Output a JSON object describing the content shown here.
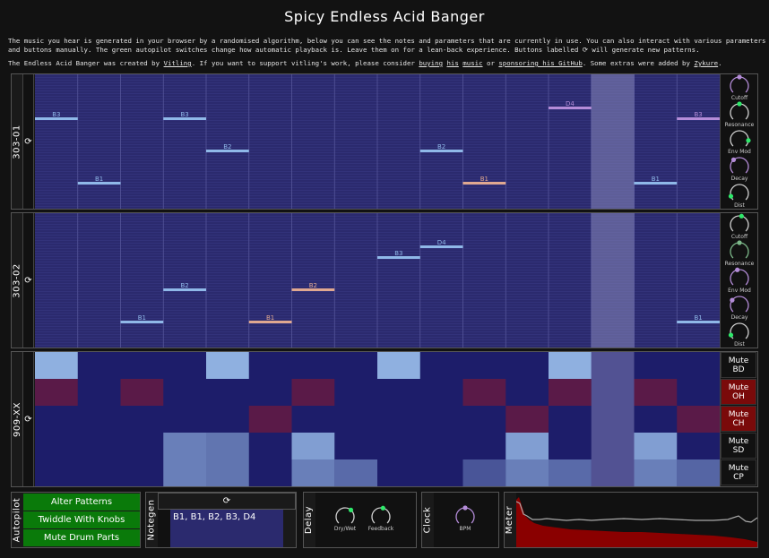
{
  "title": "Spicy Endless Acid Banger",
  "intro": {
    "para1_line1": "The music you hear is generated in your browser by a randomised algorithm, below you can see the notes and parameters that are currently in use. You can also interact with various parameters",
    "para1_line2": "and buttons manually. The green autopilot switches change how automatic playback is. Leave them on for a lean-back experience. Buttons labelled ⟳ will generate new patterns.",
    "para2_a": "The Endless Acid Banger was created by ",
    "link_vitling": "Vitling",
    "para2_b": ". If you want to support vitling's work, please consider ",
    "link_buying": "buying",
    "link_his": "his",
    "link_music": "music",
    "para2_c": " or ",
    "link_sponsor": "sponsoring his GitHub",
    "para2_d": ". Some extras were added by ",
    "link_zykure": "Zykure",
    "para2_e": "."
  },
  "regen_symbol": "⟳",
  "current_step": 13,
  "synth1": {
    "label": "303-01",
    "notes": [
      {
        "step": 0,
        "note": "B3",
        "kind": "normal"
      },
      {
        "step": 1,
        "note": "B1",
        "kind": "normal"
      },
      {
        "step": 3,
        "note": "B3",
        "kind": "normal"
      },
      {
        "step": 4,
        "note": "B2",
        "kind": "normal"
      },
      {
        "step": 9,
        "note": "B2",
        "kind": "normal"
      },
      {
        "step": 10,
        "note": "B1",
        "kind": "accent"
      },
      {
        "step": 12,
        "note": "D4",
        "kind": "slide"
      },
      {
        "step": 14,
        "note": "B1",
        "kind": "normal"
      },
      {
        "step": 15,
        "note": "B3",
        "kind": "slide"
      }
    ],
    "knobs": [
      {
        "label": "Cutoff",
        "value": 0.5,
        "color": "#b48cd8"
      },
      {
        "label": "Resonance",
        "value": 0.5,
        "color": "#2ee86a"
      },
      {
        "label": "Env Mod",
        "value": 0.85,
        "color": "#2ee86a"
      },
      {
        "label": "Decay",
        "value": 0.35,
        "color": "#b48cd8"
      },
      {
        "label": "Dist",
        "value": 0.1,
        "color": "#2ee86a"
      }
    ]
  },
  "synth2": {
    "label": "303-02",
    "notes": [
      {
        "step": 2,
        "note": "B1",
        "kind": "normal"
      },
      {
        "step": 3,
        "note": "B2",
        "kind": "normal"
      },
      {
        "step": 5,
        "note": "B1",
        "kind": "accent"
      },
      {
        "step": 6,
        "note": "B2",
        "kind": "accent"
      },
      {
        "step": 8,
        "note": "B3",
        "kind": "normal"
      },
      {
        "step": 9,
        "note": "D4",
        "kind": "normal"
      },
      {
        "step": 15,
        "note": "B1",
        "kind": "normal"
      }
    ],
    "knobs": [
      {
        "label": "Cutoff",
        "value": 0.55,
        "color": "#2ee86a"
      },
      {
        "label": "Resonance",
        "value": 0.5,
        "color": "#7cb889"
      },
      {
        "label": "Env Mod",
        "value": 0.45,
        "color": "#b48cd8"
      },
      {
        "label": "Decay",
        "value": 0.3,
        "color": "#b48cd8"
      },
      {
        "label": "Dist",
        "value": 0.1,
        "color": "#2ee86a"
      }
    ]
  },
  "drums": {
    "label": "909-XX",
    "rows": [
      {
        "mute_label": "Mute BD",
        "muted": false,
        "color": "#8fb0e0",
        "cells": [
          1,
          0,
          0,
          0,
          1,
          0,
          0,
          0,
          1,
          0,
          0,
          0,
          1,
          0,
          0,
          0
        ]
      },
      {
        "mute_label": "Mute OH",
        "muted": true,
        "color": "#5a1a48",
        "cells": [
          1,
          0,
          1,
          0,
          0,
          0,
          1,
          0,
          0,
          0,
          1,
          0,
          1,
          0,
          1,
          0
        ]
      },
      {
        "mute_label": "Mute CH",
        "muted": true,
        "color": "#5a1a48",
        "cells": [
          0,
          0,
          0,
          0,
          0,
          1,
          0,
          0,
          0,
          0,
          0,
          1,
          0,
          0,
          0,
          1
        ]
      },
      {
        "mute_label": "Mute SD",
        "muted": false,
        "color": "#8fb0e0",
        "cells": [
          0,
          0,
          0,
          0.6,
          0.5,
          0,
          0.9,
          0,
          0,
          0,
          0,
          0.9,
          0,
          0,
          0.9,
          0
        ]
      },
      {
        "mute_label": "Mute CP",
        "muted": false,
        "color": "#8fb0e0",
        "cells": [
          0,
          0,
          0,
          0.6,
          0.5,
          0,
          0.6,
          0.4,
          0,
          0,
          0.2,
          0.6,
          0.4,
          0,
          0.6,
          0.35
        ]
      }
    ]
  },
  "autopilot": {
    "label": "Autopilot",
    "buttons": [
      "Alter Patterns",
      "Twiddle With Knobs",
      "Mute Drum Parts"
    ]
  },
  "notegen": {
    "label": "Notegen",
    "notes": "B1, B1, B2, B3, D4"
  },
  "delay": {
    "label": "Delay",
    "knobs": [
      {
        "label": "Dry/Wet",
        "value": 0.65,
        "color": "#2ee86a"
      },
      {
        "label": "Feedback",
        "value": 0.55,
        "color": "#2ee86a"
      }
    ]
  },
  "clock": {
    "label": "Clock",
    "knobs": [
      {
        "label": "BPM",
        "value": 0.5,
        "color": "#b48cd8"
      }
    ]
  },
  "meter": {
    "label": "Meter"
  },
  "colors": {
    "note_normal": "#8fb8e8",
    "note_accent": "#e0a890",
    "note_slide": "#b48cd8",
    "grid_bg": "#2b2a6e",
    "drum_bg": "#1d1d6a"
  }
}
